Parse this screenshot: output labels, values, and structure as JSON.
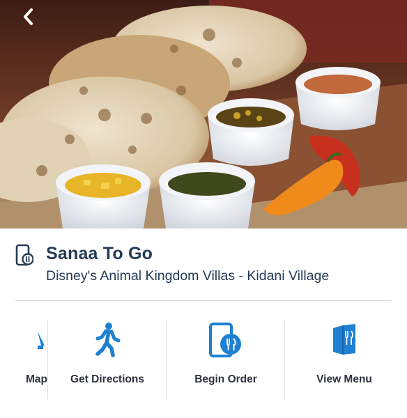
{
  "header": {
    "back_icon": "chevron-left-icon"
  },
  "location": {
    "name": "Sanaa To Go",
    "area": "Disney's Animal Kingdom Villas - Kidani Village",
    "icon": "mobile-dining-icon"
  },
  "actions": [
    {
      "label": "Map",
      "icon": "map-icon"
    },
    {
      "label": "Get Directions",
      "icon": "walking-person-icon"
    },
    {
      "label": "Begin Order",
      "icon": "mobile-order-icon"
    },
    {
      "label": "View Menu",
      "icon": "menu-book-icon"
    }
  ],
  "colors": {
    "accent": "#1f7fd1",
    "title": "#253b56"
  }
}
